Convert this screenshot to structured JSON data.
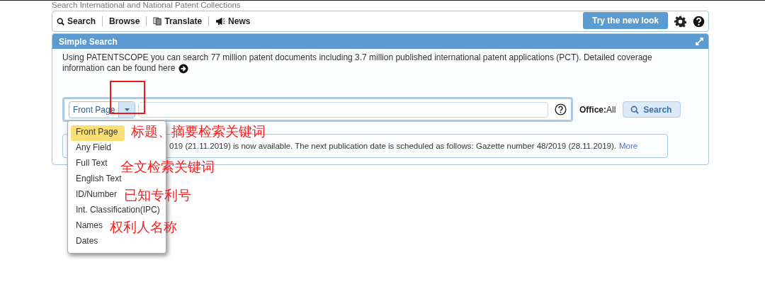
{
  "header": {
    "subtitle": "Search International and National Patent Collections"
  },
  "toolbar": {
    "items": [
      {
        "label": "Search",
        "kind": "search"
      },
      {
        "label": "Browse",
        "kind": "plain"
      },
      {
        "label": "Translate",
        "kind": "translate"
      },
      {
        "label": "News",
        "kind": "megaphone"
      }
    ],
    "new_look_button": "Try the new look"
  },
  "panel": {
    "title": "Simple Search",
    "description_lines": [
      "Using PATENTSCOPE you can search 77 million patent documents including 3.7 million published international patent applications (PCT). Detailed coverage",
      "information can be found here"
    ],
    "search": {
      "field_select": "Front Page",
      "office_label": "Office:",
      "office_value": "All",
      "button": "Search"
    },
    "notice": {
      "text": "019 (21.11.2019) is now available. The next publication date is scheduled as follows: Gazette number 48/2019 (28.11.2019).",
      "link": "More"
    }
  },
  "dropdown": {
    "options": [
      {
        "label": "Front Page",
        "selected": true
      },
      {
        "label": "Any Field",
        "selected": false
      },
      {
        "label": "Full Text",
        "selected": false
      },
      {
        "label": "English Text",
        "selected": false
      },
      {
        "label": "ID/Number",
        "selected": false
      },
      {
        "label": "Int. Classification(IPC)",
        "selected": false
      },
      {
        "label": "Names",
        "selected": false
      },
      {
        "label": "Dates",
        "selected": false
      }
    ]
  },
  "annotations": [
    {
      "kind": "box"
    },
    {
      "kind": "note",
      "text": "标题、摘要检索关键词"
    },
    {
      "kind": "note",
      "text": "全文检索关键词"
    },
    {
      "kind": "note",
      "text": "已知专利号"
    },
    {
      "kind": "note",
      "text": "权利人名称"
    }
  ]
}
